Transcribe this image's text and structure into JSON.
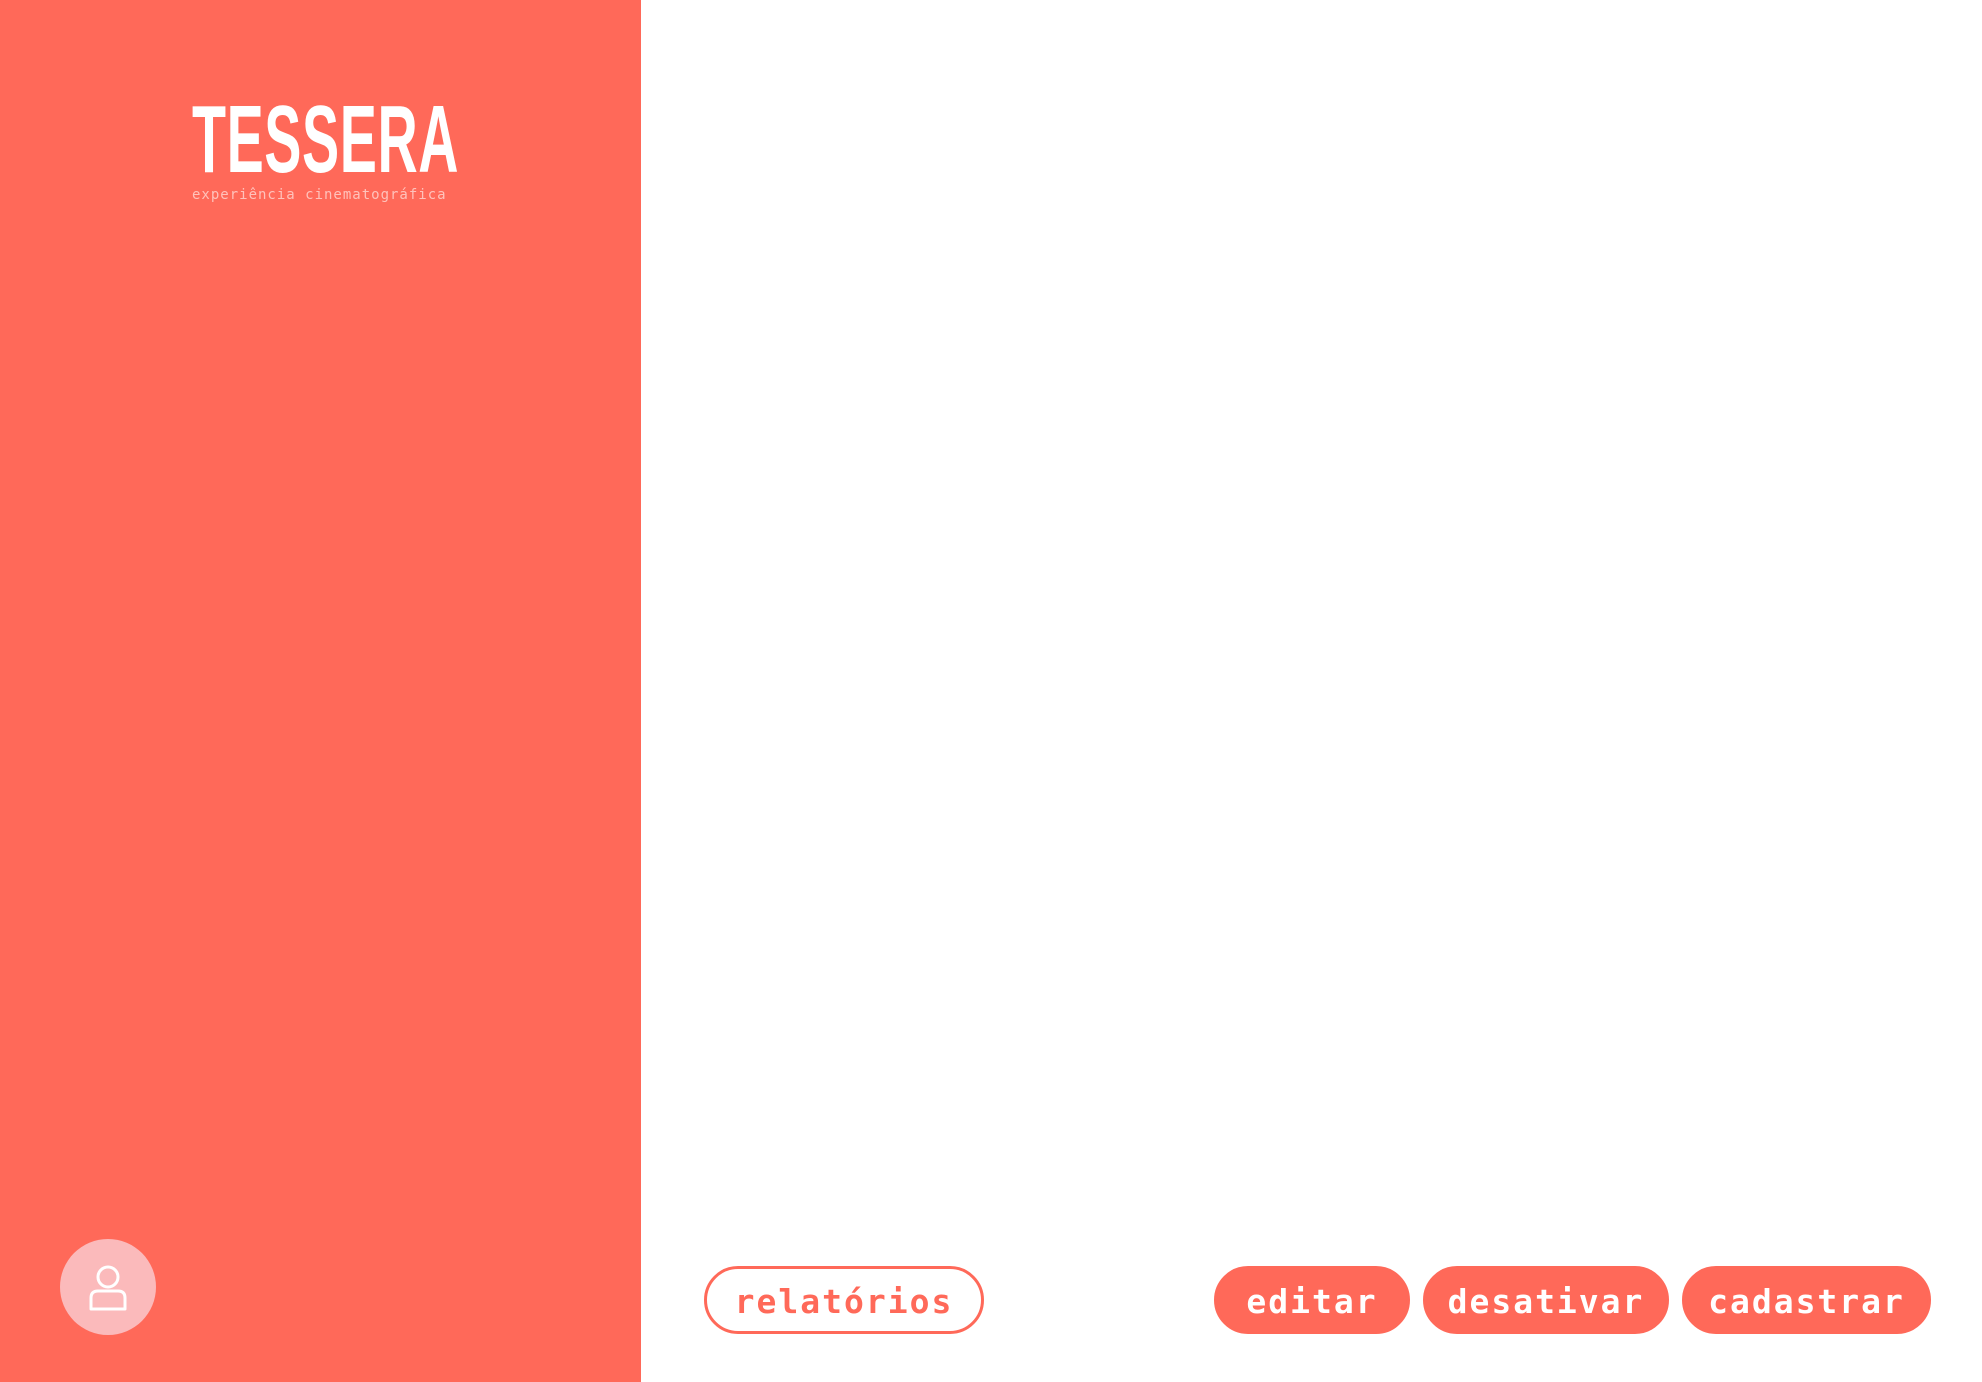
{
  "brand": {
    "name": "TESSERA",
    "tagline": "experiência cinematográfica"
  },
  "user_menu": {
    "icon": "user-icon"
  },
  "actions": {
    "reports_label": "relatórios",
    "edit_label": "editar",
    "deactivate_label": "desativar",
    "register_label": "cadastrar"
  },
  "colors": {
    "accent": "#ff6959",
    "avatar_bg": "#fbbabb",
    "background": "#ffffff"
  }
}
